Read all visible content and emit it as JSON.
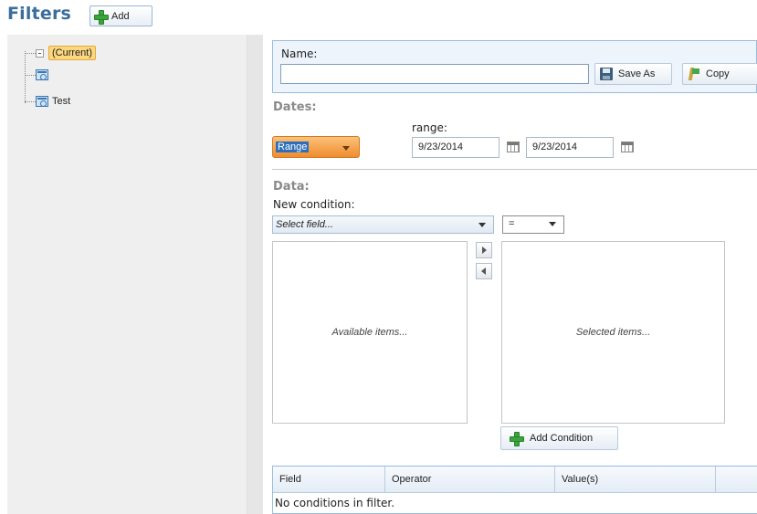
{
  "header": {
    "title": "Filters",
    "add_label": "Add"
  },
  "tree": {
    "items": [
      {
        "label": "(Current)",
        "icon": "expander-icon",
        "selected": true
      },
      {
        "label": "",
        "icon": "filter-icon"
      },
      {
        "label": "Test",
        "icon": "filter-icon"
      }
    ]
  },
  "name_section": {
    "label": "Name:",
    "value": "",
    "save_as_label": "Save As",
    "copy_label": "Copy"
  },
  "dates": {
    "title": "Dates:",
    "mode": "Range",
    "range_label": "range:",
    "from": "9/23/2014",
    "to": "9/23/2014"
  },
  "data": {
    "title": "Data:",
    "new_condition_label": "New condition:",
    "field_placeholder": "Select field...",
    "operator": "=",
    "available_placeholder": "Available items...",
    "selected_placeholder": "Selected items...",
    "add_condition_label": "Add Condition"
  },
  "grid": {
    "columns": [
      "Field",
      "Operator",
      "Value(s)",
      ""
    ],
    "empty_text": "No conditions in filter."
  },
  "colors": {
    "title": "#3b6e9c",
    "accent_orange": "#f08c2e",
    "panel_border": "#99bbdd"
  }
}
